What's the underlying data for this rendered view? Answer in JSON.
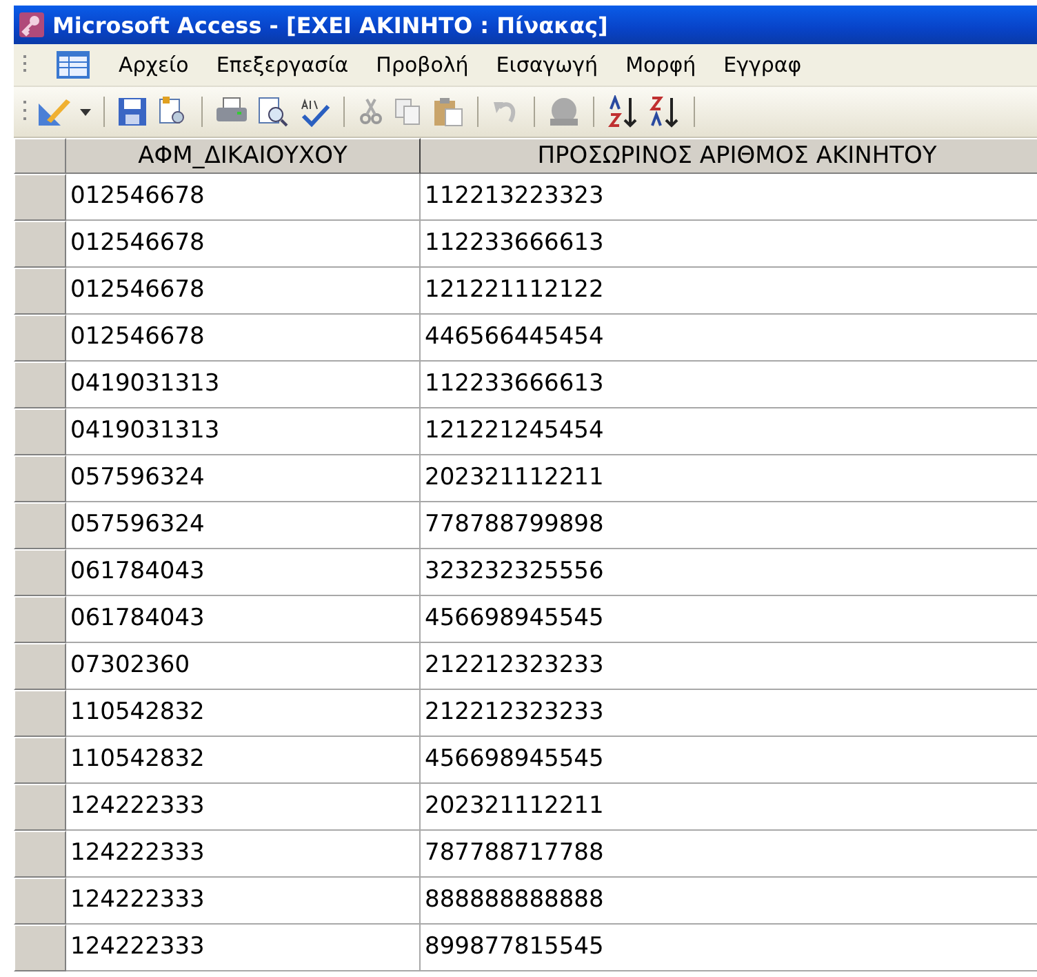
{
  "window": {
    "title": "Microsoft Access - [ΕΧΕΙ ΑΚΙΝΗΤΟ : Πίνακας]"
  },
  "menu": [
    "Αρχείο",
    "Επεξεργασία",
    "Προβολή",
    "Εισαγωγή",
    "Μορφή",
    "Εγγραφ"
  ],
  "table": {
    "columns": [
      "ΑΦΜ_ΔΙΚΑΙΟΥΧΟΥ",
      "ΠΡΟΣΩΡΙΝΟΣ ΑΡΙΘΜΟΣ ΑΚΙΝΗΤΟΥ"
    ],
    "rows": [
      [
        "012546678",
        "112213223323"
      ],
      [
        "012546678",
        "112233666613"
      ],
      [
        "012546678",
        "121221112122"
      ],
      [
        "012546678",
        "446566445454"
      ],
      [
        "0419031313",
        "112233666613"
      ],
      [
        "0419031313",
        "121221245454"
      ],
      [
        "057596324",
        "202321112211"
      ],
      [
        "057596324",
        "778788799898"
      ],
      [
        "061784043",
        "323232325556"
      ],
      [
        "061784043",
        "456698945545"
      ],
      [
        "07302360",
        "212212323233"
      ],
      [
        "110542832",
        "212212323233"
      ],
      [
        "110542832",
        "456698945545"
      ],
      [
        "124222333",
        "202321112211"
      ],
      [
        "124222333",
        "787788717788"
      ],
      [
        "124222333",
        "888888888888"
      ],
      [
        "124222333",
        "899877815545"
      ]
    ]
  }
}
